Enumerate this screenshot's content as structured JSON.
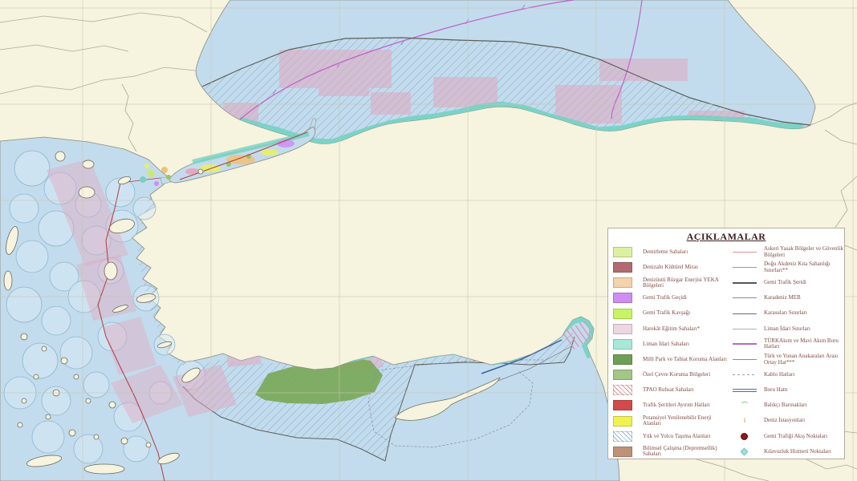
{
  "legend": {
    "title": "AÇIKLAMALAR",
    "left_items": [
      {
        "label": "Demirleme Sahaları",
        "swatch": {
          "type": "fill",
          "color": "#dcf0a0"
        }
      },
      {
        "label": "Denizaltı Kültürel Miras",
        "swatch": {
          "type": "fill",
          "color": "#b26b70"
        }
      },
      {
        "label": "Denizüstü Rüzgar Enerjisi YEKA Bölgeleri",
        "swatch": {
          "type": "fill",
          "color": "#f4d2ac"
        }
      },
      {
        "label": "Gemi Trafik Geçidi",
        "swatch": {
          "type": "fill",
          "color": "#cf8df2"
        }
      },
      {
        "label": "Gemi Trafik Kavşağı",
        "swatch": {
          "type": "fill",
          "color": "#c8f463"
        }
      },
      {
        "label": "Harekât Eğitim Sahaları*",
        "swatch": {
          "type": "fill",
          "color": "#ecd6e2"
        }
      },
      {
        "label": "Liman İdari Sahaları",
        "swatch": {
          "type": "fill",
          "color": "#a9e8d8"
        }
      },
      {
        "label": "Milli Park ve Tabiat Koruma Alanları",
        "swatch": {
          "type": "fill",
          "color": "#6f9f55"
        }
      },
      {
        "label": "Özel Çevre Koruma Bölgeleri",
        "swatch": {
          "type": "fill",
          "color": "#a3c687"
        }
      },
      {
        "label": "TPAO Ruhsat Sahaları",
        "swatch": {
          "type": "hatch",
          "color": "#e68a96"
        }
      },
      {
        "label": "Trafik Şeritleri Ayırım Hatları",
        "swatch": {
          "type": "fill",
          "color": "#d24a4a"
        }
      },
      {
        "label": "Potansiyel Yenilenebilir Enerji Alanları",
        "swatch": {
          "type": "fill",
          "color": "#eff24f"
        }
      },
      {
        "label": "Yük ve Yolcu Taşıma Alanları",
        "swatch": {
          "type": "hatch",
          "color": "#9fb6d4"
        }
      },
      {
        "label": "Bilimsel Çalışma (Depremsellik) Sahaları",
        "swatch": {
          "type": "fill",
          "color": "#bd9277"
        }
      }
    ],
    "right_items": [
      {
        "label": "Askeri Yasak Bölgeler ve Güvenlik Bölgeleri",
        "marker": {
          "type": "line",
          "color": "#e09098",
          "weight": 1
        }
      },
      {
        "label": "Doğu Akdeniz Kıta Sahanlığı Sınırları**",
        "marker": {
          "type": "line",
          "color": "#9a9a9a",
          "weight": 1
        }
      },
      {
        "label": "Gemi Trafik Şeridi",
        "marker": {
          "type": "line",
          "color": "#55555f",
          "weight": 2
        }
      },
      {
        "label": "Karadeniz MEB",
        "marker": {
          "type": "line",
          "color": "#8a8a96",
          "weight": 1
        }
      },
      {
        "label": "Karasuları Sınırları",
        "marker": {
          "type": "line",
          "color": "#6a6a78",
          "weight": 1
        }
      },
      {
        "label": "Liman İdari Sınırları",
        "marker": {
          "type": "line",
          "color": "#aab0b8",
          "weight": 1
        }
      },
      {
        "label": "TÜRKAkım ve Mavi Akım Boru Hatları",
        "marker": {
          "type": "line",
          "color": "#b06cc8",
          "weight": 2
        }
      },
      {
        "label": "Türk ve Yunan Anakaraları Arası Ortay Hat***",
        "marker": {
          "type": "line",
          "color": "#8a8a96",
          "weight": 1
        }
      },
      {
        "label": "Kablo Hatları",
        "marker": {
          "type": "dashed",
          "color": "#9a9aa4",
          "weight": 1
        }
      },
      {
        "label": "Boru Hattı",
        "marker": {
          "type": "double",
          "color": "#4a6aaa",
          "weight": 4
        }
      },
      {
        "label": "Balıkçı Barınakları",
        "marker": {
          "type": "symbol",
          "color": "#4aa048",
          "glyph": "⌒"
        }
      },
      {
        "label": "Deniz İstasyonları",
        "marker": {
          "type": "symbol",
          "color": "#d06030",
          "glyph": "i"
        }
      },
      {
        "label": "Gemi Trafiği Akış Noktaları",
        "marker": {
          "type": "dot",
          "color": "#8b1a1a"
        }
      },
      {
        "label": "Kılavuzluk Hizmeti Noktaları",
        "marker": {
          "type": "diamond",
          "color": "#9fe0dc"
        }
      }
    ]
  },
  "colors": {
    "land": "#f6f3de",
    "sea": "#c2dcee",
    "scallop_fill": "#d8eaf6",
    "coastline": "#8a8878",
    "grid": "#c9c4ae",
    "country_border": "#b0a893",
    "tpao_hatch": "#7f9cba",
    "military_pink": "#e2a8bf",
    "port_teal": "#74d2c2",
    "pipeline_magenta": "#bf63c9",
    "boundary_dark": "#5f5f55",
    "median_red": "#b23a3a",
    "protection_green": "#79a757",
    "scallop_stroke": "#8fb6cc",
    "marmara_orange": "#eec27c",
    "marmara_yellow": "#e9ef66",
    "marmara_purple": "#cf8df2",
    "marmara_green": "#9ac45f",
    "cyprus_line_blue": "#3f5f9f"
  }
}
